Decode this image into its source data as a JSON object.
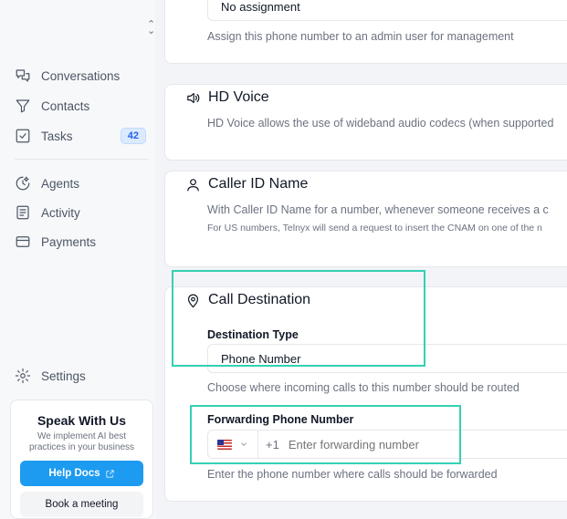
{
  "sidebar": {
    "nav": [
      {
        "label": "Conversations",
        "icon": "conversations-icon"
      },
      {
        "label": "Contacts",
        "icon": "filter-icon"
      },
      {
        "label": "Tasks",
        "icon": "checkbox-icon",
        "badge": "42"
      },
      {
        "label": "Agents",
        "icon": "agents-icon"
      },
      {
        "label": "Activity",
        "icon": "activity-icon"
      },
      {
        "label": "Payments",
        "icon": "payments-icon"
      }
    ],
    "settings_label": "Settings",
    "promo": {
      "title": "Speak With Us",
      "text": "We implement AI best practices in your business",
      "help_label": "Help Docs",
      "book_label": "Book a meeting"
    }
  },
  "assignment": {
    "value": "No assignment",
    "description": "Assign this phone number to an admin user for management"
  },
  "hd_voice": {
    "title": "HD Voice",
    "description": "HD Voice allows the use of wideband audio codecs (when supported"
  },
  "caller_id": {
    "title": "Caller ID Name",
    "description": "With Caller ID Name for a number, whenever someone receives a c",
    "note": "For US numbers, Telnyx will send a request to insert the CNAM on one of the n"
  },
  "call_destination": {
    "title": "Call Destination",
    "destination_label": "Destination Type",
    "destination_value": "Phone Number",
    "destination_help": "Choose where incoming calls to this number should be routed",
    "forwarding_label": "Forwarding Phone Number",
    "country_code": "+1",
    "forwarding_placeholder": "Enter forwarding number",
    "forwarding_help": "Enter the phone number where calls should be forwarded"
  },
  "colors": {
    "accent": "#1d9bf0",
    "highlight": "#34d1b4",
    "badge_text": "#2563eb"
  }
}
